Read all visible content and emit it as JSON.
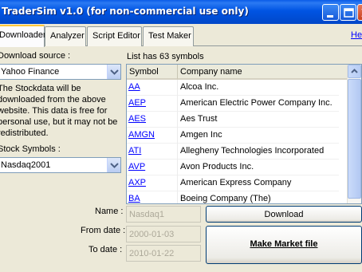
{
  "window": {
    "title": "TraderSim v1.0  (for non-commercial use only)"
  },
  "tabs": [
    {
      "label": "Downloader",
      "active": true
    },
    {
      "label": "Analyzer",
      "active": false
    },
    {
      "label": "Script Editor",
      "active": false
    },
    {
      "label": "Test Maker",
      "active": false
    }
  ],
  "help_link": "He",
  "left_panel": {
    "download_source_label": "Download source :",
    "download_source_value": "Yahoo Finance",
    "description_lines": [
      "The Stockdata will be",
      "downloaded from the above",
      "website. This data is free for",
      "personal use, but it may not be",
      "redistributed."
    ],
    "stock_symbols_label": "Stock Symbols :",
    "stock_symbols_value": "Nasdaq2001"
  },
  "symbols_list": {
    "count_text": "List has 63 symbols",
    "columns": [
      "Symbol",
      "Company name"
    ],
    "rows": [
      {
        "symbol": "AA",
        "company": "Alcoa Inc."
      },
      {
        "symbol": "AEP",
        "company": "American Electric Power Company Inc."
      },
      {
        "symbol": "AES",
        "company": "Aes Trust"
      },
      {
        "symbol": "AMGN",
        "company": "Amgen Inc"
      },
      {
        "symbol": "ATI",
        "company": "Allegheny Technologies Incorporated"
      },
      {
        "symbol": "AVP",
        "company": "Avon Products Inc."
      },
      {
        "symbol": "AXP",
        "company": "American Express Company"
      },
      {
        "symbol": "BA",
        "company": "Boeing Company (The)"
      }
    ]
  },
  "form": {
    "name_label": "Name :",
    "name_value": "Nasdaq1",
    "from_label": "From date :",
    "from_value": "2000-01-03",
    "to_label": "To date :",
    "to_value": "2010-01-22"
  },
  "buttons": {
    "download": "Download",
    "make_market_file": "Make Market file"
  },
  "colors": {
    "titlebar": "#0054e3",
    "link": "#0000ff",
    "active_tab_accent": "#ffc83c"
  }
}
